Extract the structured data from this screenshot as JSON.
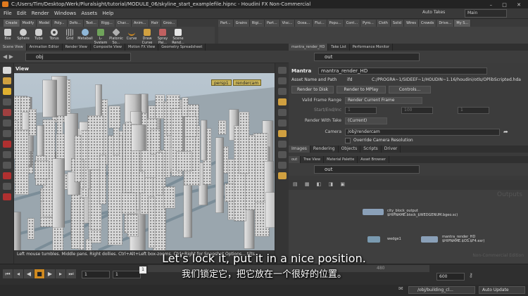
{
  "window": {
    "title": "C:/Users/Tim/Desktop/Werk/Pluralsight/tutorial/MODULE_06/skyline_start_examplefile.hipnc - Houdini FX Non-Commercial",
    "controls": "–  □  ✕"
  },
  "menu": [
    "File",
    "Edit",
    "Render",
    "Windows",
    "Assets",
    "Help"
  ],
  "toolbar": {
    "auto_takes": "Auto Takes",
    "desktop": "Main"
  },
  "shelf_tabs_left": [
    "Create",
    "Modify",
    "Model",
    "Poly...",
    "Defo...",
    "Text...",
    "Rigg...",
    "Char...",
    "Anim...",
    "Hair",
    "Groo..."
  ],
  "shelf_tabs_right": [
    "Part...",
    "Grains",
    "Rigi...",
    "Part...",
    "Visc...",
    "Ocea...",
    "Flui...",
    "Popu...",
    "Cont...",
    "Pyro...",
    "Cloth",
    "Solid",
    "Wires",
    "Crowds",
    "Drive...",
    "My S..."
  ],
  "shelf_tools": [
    "Box",
    "Sphere",
    "Tube",
    "Torus",
    "Grid",
    "Metaball",
    "L-System",
    "Platonic So...",
    "Curve",
    "Draw Curve",
    "Spray Pai...",
    "Scene Rend..."
  ],
  "left_pane": {
    "tabs": [
      "Scene View",
      "Animation Editor",
      "Render View",
      "Composite View",
      "Motion FX View",
      "Geometry Spreadsheet"
    ],
    "path": "obj",
    "view_label": "View",
    "camera": [
      "persp1",
      "rendercam"
    ],
    "status": "Left mouse tumbles. Middle pans. Right dollies. Ctrl+Alt+Left box-zooms. Ctrl+Right for Snapshot Options... tilts."
  },
  "param_pane": {
    "tabs": [
      "mantra_render_HD",
      "Take List",
      "Performance Monitor"
    ],
    "path": "out",
    "node_type": "Mantra",
    "node_name": "mantra_render_HD",
    "asset_label": "Asset Name and Path",
    "asset_id": "ifd",
    "asset_path": "C:/PROGRA~1/SIDEEF~1/HOUDIN~1.16/houdini/otls/OPlibScripted.hda",
    "buttons": [
      "Render to Disk",
      "Render to MPlay",
      "Controls..."
    ],
    "valid_frame_range_label": "Valid Frame Range",
    "valid_frame_range": "Render Current Frame",
    "start_end_label": "Start/End/Inc",
    "start_end": [
      "1",
      "100",
      "1"
    ],
    "take_label": "Render With Take",
    "take": "(Current)",
    "camera_label": "Camera",
    "camera": "/obj/rendercam",
    "override": "Override Camera Resolution",
    "tabs_bottom": [
      "Images",
      "Rendering",
      "Objects",
      "Scripts",
      "Driver"
    ]
  },
  "network_pane": {
    "tabs": [
      "out",
      "Tree View",
      "Material Palette",
      "Asset Browser"
    ],
    "path": "out",
    "watermark": "Outputs",
    "nodes": [
      {
        "name": "city_block_output",
        "sub": "$HIPNAME.block_$WEDGENUM.bgeo.sc)"
      },
      {
        "name": "wedge1",
        "sub": ""
      },
      {
        "name": "mantra_render_HD",
        "sub": "$HIPNAME.$OS.$F4.exr)"
      }
    ],
    "corner_text": "Non-Commercial Edition"
  },
  "timeline": {
    "frame": "1",
    "start": "1",
    "end": "600",
    "ticks": [
      "1",
      "",
      "",
      "",
      "480",
      ""
    ],
    "marker": "1"
  },
  "statusbar": {
    "net_path": "/obj/building_cl...",
    "auto_update": "Auto Update"
  },
  "subtitles": {
    "en": "Let's lock it, put it in a nice position.",
    "zh": "我们锁定它，把它放在一个很好的位置。"
  }
}
